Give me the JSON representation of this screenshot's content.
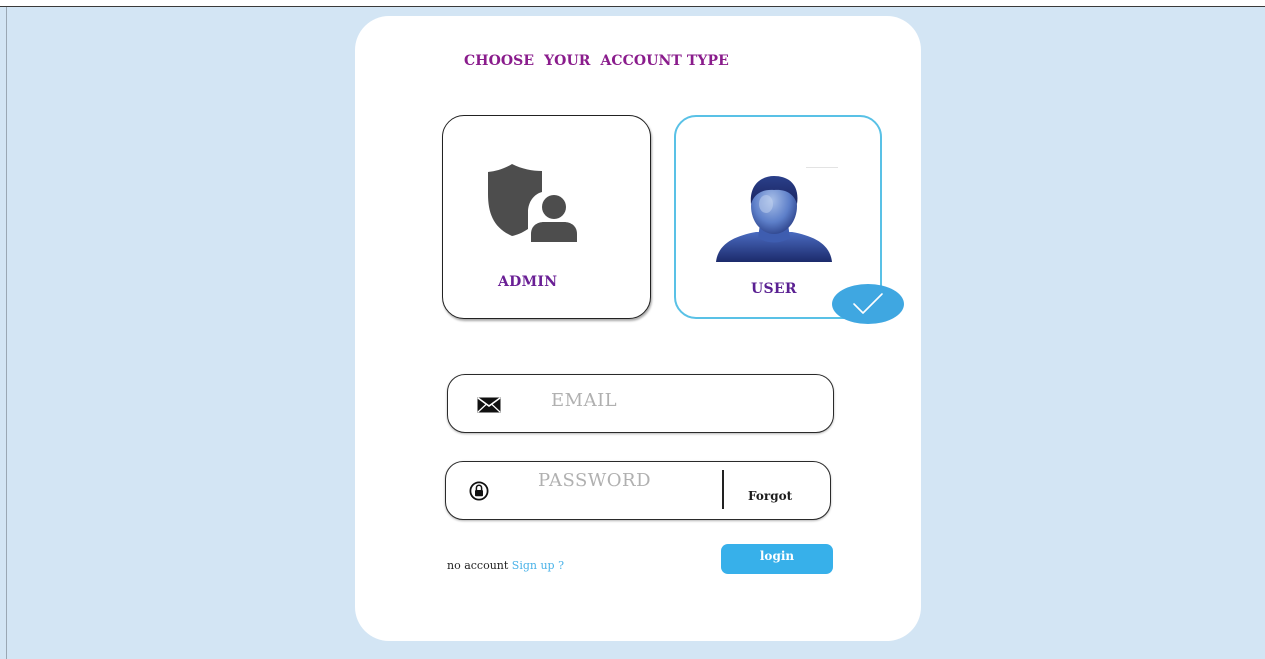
{
  "heading": "CHOOSE  YOUR  ACCOUNT TYPE",
  "account_types": {
    "admin": {
      "label": "ADMIN",
      "icon": "admin-shield-user-icon",
      "selected": false
    },
    "user": {
      "label": "USER",
      "icon": "user-avatar-icon",
      "selected": true
    }
  },
  "email": {
    "placeholder": "EMAIL",
    "value": "",
    "icon": "envelope-icon"
  },
  "password": {
    "placeholder": "PASSWORD",
    "value": "",
    "icon": "lock-icon",
    "forgot_label": "Forgot"
  },
  "signup": {
    "prompt": "no account",
    "link": "Sign up ?"
  },
  "login_label": "login",
  "colors": {
    "background": "#d3e5f4",
    "card": "#ffffff",
    "heading": "#8a1c8c",
    "type_label": "#6a1f95",
    "accent": "#37b0ea",
    "selected_border": "#59c1e6"
  }
}
